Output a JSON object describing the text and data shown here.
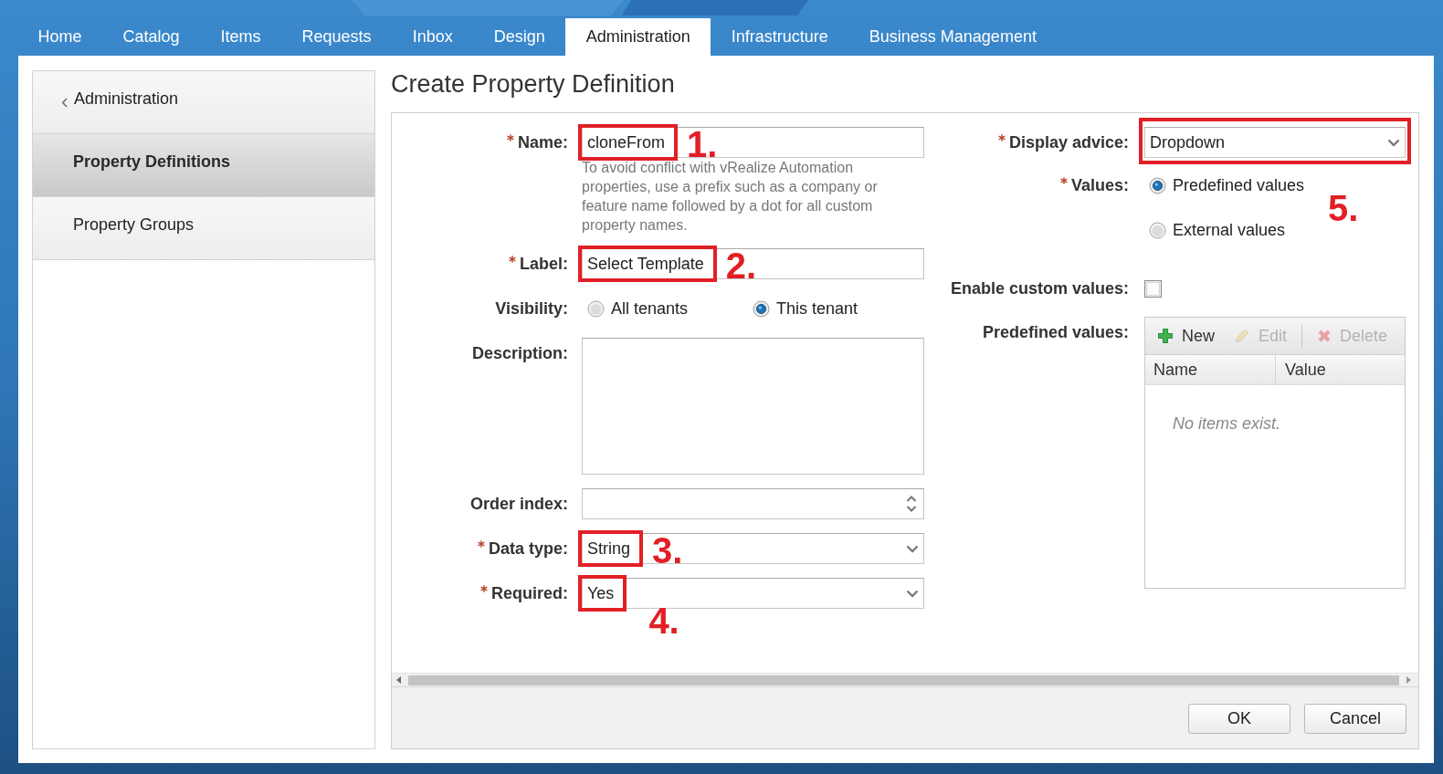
{
  "tabs": [
    {
      "label": "Home",
      "selected": false
    },
    {
      "label": "Catalog",
      "selected": false
    },
    {
      "label": "Items",
      "selected": false
    },
    {
      "label": "Requests",
      "selected": false
    },
    {
      "label": "Inbox",
      "selected": false
    },
    {
      "label": "Design",
      "selected": false
    },
    {
      "label": "Administration",
      "selected": true
    },
    {
      "label": "Infrastructure",
      "selected": false
    },
    {
      "label": "Business Management",
      "selected": false
    }
  ],
  "sidebar": {
    "back_link": "Administration",
    "items": [
      {
        "label": "Property Definitions",
        "selected": true
      },
      {
        "label": "Property Groups",
        "selected": false
      }
    ]
  },
  "page_title": "Create Property Definition",
  "form": {
    "left_column": [
      {
        "kind": "text",
        "label": "Name:",
        "required": true,
        "value": "cloneFrom",
        "help": "To avoid conflict with vRealize Automation properties, use a prefix such as a company or feature name followed by a dot for all custom property names.",
        "callout": {
          "number": "1.",
          "below": false
        }
      },
      {
        "kind": "text",
        "label": "Label:",
        "required": true,
        "value": "Select Template",
        "callout": {
          "number": "2.",
          "below": false
        }
      },
      {
        "kind": "radio",
        "label": "Visibility:",
        "required": false,
        "options": [
          {
            "label": "All tenants",
            "selected": false
          },
          {
            "label": "This tenant",
            "selected": true
          }
        ]
      },
      {
        "kind": "textarea",
        "label": "Description:",
        "required": false
      },
      {
        "kind": "number",
        "label": "Order index:",
        "required": false
      },
      {
        "kind": "select",
        "label": "Data type:",
        "required": true,
        "value": "String",
        "callout": {
          "number": "3.",
          "below": false
        }
      },
      {
        "kind": "select",
        "label": "Required:",
        "required": true,
        "value": "Yes",
        "callout": {
          "number": "4.",
          "below": true
        }
      }
    ],
    "right_column": [
      {
        "kind": "select",
        "label": "Display advice:",
        "required": true,
        "value": "Dropdown",
        "highlighted": true
      },
      {
        "kind": "radiostack",
        "label": "Values:",
        "required": true,
        "options": [
          {
            "label": "Predefined values",
            "selected": true
          },
          {
            "label": "External values",
            "selected": false
          }
        ],
        "callout": {
          "number": "5.",
          "below": false
        }
      },
      {
        "kind": "checkbox",
        "label": "Enable custom values:",
        "required": false,
        "checked": false
      },
      {
        "kind": "grid",
        "label": "Predefined values:",
        "required": false,
        "toolbar": [
          {
            "kind": "add",
            "label": "New",
            "disabled": false
          },
          {
            "kind": "edit",
            "label": "Edit",
            "disabled": true
          },
          {
            "kind": "delete",
            "label": "Delete",
            "disabled": true
          }
        ],
        "columns": [
          "Name",
          "Value"
        ],
        "empty_message": "No items exist."
      }
    ]
  },
  "buttons": [
    "OK",
    "Cancel"
  ]
}
